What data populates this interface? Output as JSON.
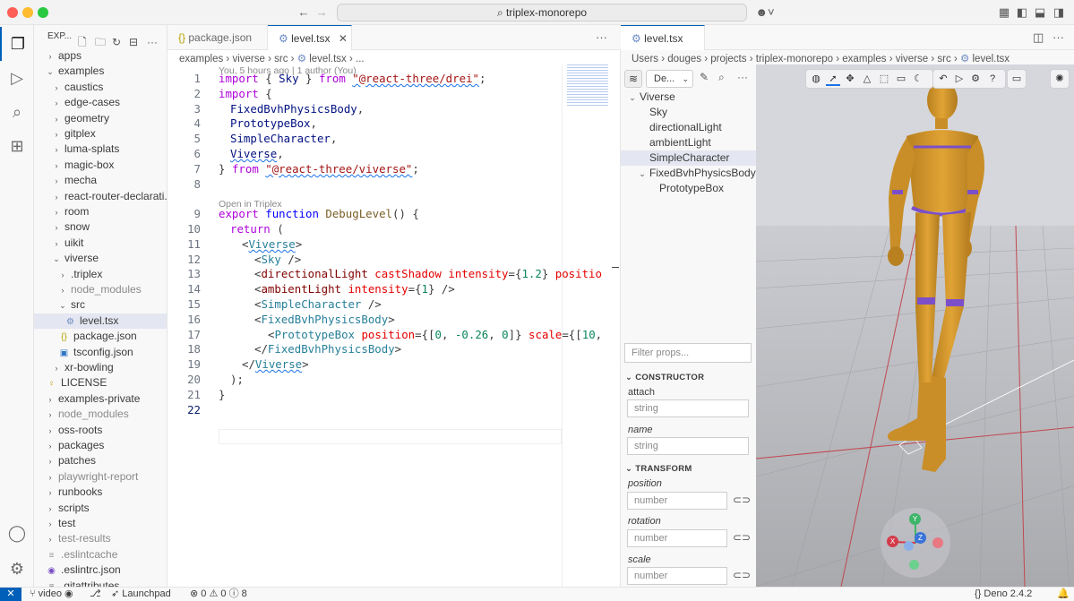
{
  "window": {
    "title": "triplex-monorepo",
    "accent": "#005fb8"
  },
  "activity_bar": {
    "items": [
      "explorer-icon",
      "run-debug-icon",
      "search-icon",
      "extensions-icon"
    ],
    "bottom": [
      "account-icon",
      "settings-icon"
    ]
  },
  "explorer": {
    "header": "EXP...",
    "items": [
      {
        "label": "apps",
        "kind": "folder",
        "indent": 1,
        "open": false
      },
      {
        "label": "examples",
        "kind": "folder",
        "indent": 1,
        "open": true
      },
      {
        "label": "caustics",
        "kind": "folder",
        "indent": 2,
        "open": false
      },
      {
        "label": "edge-cases",
        "kind": "folder",
        "indent": 2,
        "open": false
      },
      {
        "label": "geometry",
        "kind": "folder",
        "indent": 2,
        "open": false
      },
      {
        "label": "gitplex",
        "kind": "folder",
        "indent": 2,
        "open": false
      },
      {
        "label": "luma-splats",
        "kind": "folder",
        "indent": 2,
        "open": false
      },
      {
        "label": "magic-box",
        "kind": "folder",
        "indent": 2,
        "open": false
      },
      {
        "label": "mecha",
        "kind": "folder",
        "indent": 2,
        "open": false
      },
      {
        "label": "react-router-declarati...",
        "kind": "folder",
        "indent": 2,
        "open": false
      },
      {
        "label": "room",
        "kind": "folder",
        "indent": 2,
        "open": false
      },
      {
        "label": "snow",
        "kind": "folder",
        "indent": 2,
        "open": false
      },
      {
        "label": "uikit",
        "kind": "folder",
        "indent": 2,
        "open": false
      },
      {
        "label": "viverse",
        "kind": "folder",
        "indent": 2,
        "open": true
      },
      {
        "label": ".triplex",
        "kind": "folder",
        "indent": 3,
        "open": false
      },
      {
        "label": "node_modules",
        "kind": "folder-dim",
        "indent": 3,
        "open": false
      },
      {
        "label": "src",
        "kind": "folder",
        "indent": 3,
        "open": true
      },
      {
        "label": "level.tsx",
        "kind": "tsx",
        "indent": 4,
        "selected": true
      },
      {
        "label": "package.json",
        "kind": "json",
        "indent": 3
      },
      {
        "label": "tsconfig.json",
        "kind": "tsconfig",
        "indent": 3
      },
      {
        "label": "xr-bowling",
        "kind": "folder",
        "indent": 2,
        "open": false
      },
      {
        "label": "LICENSE",
        "kind": "license",
        "indent": 1
      },
      {
        "label": "examples-private",
        "kind": "folder",
        "indent": 1,
        "open": false
      },
      {
        "label": "node_modules",
        "kind": "folder-dim",
        "indent": 1,
        "open": false
      },
      {
        "label": "oss-roots",
        "kind": "folder",
        "indent": 1,
        "open": false
      },
      {
        "label": "packages",
        "kind": "folder",
        "indent": 1,
        "open": false
      },
      {
        "label": "patches",
        "kind": "folder",
        "indent": 1,
        "open": false
      },
      {
        "label": "playwright-report",
        "kind": "folder-dim",
        "indent": 1,
        "open": false
      },
      {
        "label": "runbooks",
        "kind": "folder",
        "indent": 1,
        "open": false
      },
      {
        "label": "scripts",
        "kind": "folder",
        "indent": 1,
        "open": false
      },
      {
        "label": "test",
        "kind": "folder",
        "indent": 1,
        "open": false
      },
      {
        "label": "test-results",
        "kind": "folder-dim",
        "indent": 1,
        "open": false
      },
      {
        "label": ".eslintcache",
        "kind": "plain-dim",
        "indent": 1
      },
      {
        "label": ".eslintrc.json",
        "kind": "eslint",
        "indent": 1
      },
      {
        "label": ".gitattributes",
        "kind": "plain",
        "indent": 1
      }
    ]
  },
  "editor": {
    "tabs": [
      {
        "label": "package.json",
        "icon": "{}",
        "active": false
      },
      {
        "label": "level.tsx",
        "icon": "⚙",
        "active": true
      }
    ],
    "breadcrumb": [
      "examples",
      "viverse",
      "src",
      "level.tsx",
      "..."
    ],
    "codelens_blame": "You, 5 hours ago | 1 author (You)",
    "codelens_open": "Open in Triplex",
    "line_numbers": [
      "1",
      "2",
      "3",
      "4",
      "5",
      "6",
      "7",
      "8",
      "9",
      "10",
      "11",
      "12",
      "13",
      "14",
      "15",
      "16",
      "17",
      "18",
      "19",
      "20",
      "21",
      "22"
    ],
    "lines": {
      "l1": [
        "import",
        " { ",
        "Sky",
        " } ",
        "from",
        " ",
        "\"@react-three/drei\"",
        ";"
      ],
      "l2": [
        "import",
        " {"
      ],
      "l3": [
        "FixedBvhPhysicsBody",
        ","
      ],
      "l4": [
        "PrototypeBox",
        ","
      ],
      "l5": [
        "SimpleCharacter",
        ","
      ],
      "l6": [
        "Viverse",
        ","
      ],
      "l7": [
        "}",
        " ",
        "from",
        " ",
        "\"@react-three/viverse\"",
        ";"
      ],
      "l9": [
        "export",
        " ",
        "function",
        " ",
        "DebugLevel",
        "() {"
      ],
      "l10": [
        "return",
        " ("
      ],
      "l11": [
        "<",
        "Viverse",
        ">"
      ],
      "l12": [
        "<",
        "Sky",
        " />"
      ],
      "l13": [
        "<",
        "directionalLight",
        " ",
        "castShadow",
        " ",
        "intensity",
        "={",
        "1.2",
        "} ",
        "positio"
      ],
      "l14": [
        "<",
        "ambientLight",
        " ",
        "intensity",
        "={",
        "1",
        "} />"
      ],
      "l15": [
        "<",
        "SimpleCharacter",
        " />"
      ],
      "l16": [
        "<",
        "FixedBvhPhysicsBody",
        ">"
      ],
      "l17": [
        "<",
        "PrototypeBox",
        " ",
        "position",
        "={[",
        "0",
        ", ",
        "-0.26",
        ", ",
        "0",
        "]} ",
        "scale",
        "={[",
        "10",
        ","
      ],
      "l18": [
        "</",
        "FixedBvhPhysicsBody",
        ">"
      ],
      "l19": [
        "</",
        "Viverse",
        ">"
      ],
      "l20": [
        ");"
      ],
      "l21": [
        "}"
      ]
    }
  },
  "right_pane": {
    "tab": {
      "label": "level.tsx",
      "icon": "⚙"
    },
    "breadcrumb": [
      "Users",
      "douges",
      "projects",
      "triplex-monorepo",
      "examples",
      "viverse",
      "src",
      "level.tsx"
    ],
    "component_select": "De...",
    "scene_tree": [
      {
        "label": "Viverse",
        "indent": 0,
        "open": true
      },
      {
        "label": "Sky",
        "indent": 1
      },
      {
        "label": "directionalLight",
        "indent": 1
      },
      {
        "label": "ambientLight",
        "indent": 1
      },
      {
        "label": "SimpleCharacter",
        "indent": 1,
        "selected": true
      },
      {
        "label": "FixedBvhPhysicsBody",
        "indent": 1,
        "open": true
      },
      {
        "label": "PrototypeBox",
        "indent": 2
      }
    ],
    "filter_placeholder": "Filter props...",
    "sections": {
      "constructor": "CONSTRUCTOR",
      "transform": "TRANSFORM"
    },
    "props": {
      "attach": {
        "label": "attach",
        "placeholder": "string"
      },
      "name": {
        "label": "name",
        "placeholder": "string"
      },
      "position": {
        "label": "position",
        "placeholder": "number"
      },
      "rotation": {
        "label": "rotation",
        "placeholder": "number"
      },
      "scale": {
        "label": "scale",
        "placeholder": "number"
      }
    }
  },
  "viewport": {
    "toolbar1_icons": [
      "globe-icon",
      "select-icon",
      "move-icon",
      "rotate-icon",
      "scale-icon",
      "camera-icon",
      "grid-icon"
    ],
    "toolbar2_icons": [
      "undo-icon",
      "play-icon",
      "settings-icon",
      "help-icon"
    ],
    "toolbar3_icons": [
      "screen-icon"
    ],
    "gizmo_labels": {
      "y": "Y",
      "x": "X",
      "z": "Z"
    },
    "colors": {
      "character": "#d89a2c",
      "character_trim": "#7b4fc9",
      "grid_line": "#c0484f"
    }
  },
  "status_bar": {
    "remote": "✕",
    "branch": "video",
    "launchpad": "Launchpad",
    "errors": "0",
    "warnings": "0",
    "info": "8",
    "runtime": "Deno 2.4.2"
  }
}
